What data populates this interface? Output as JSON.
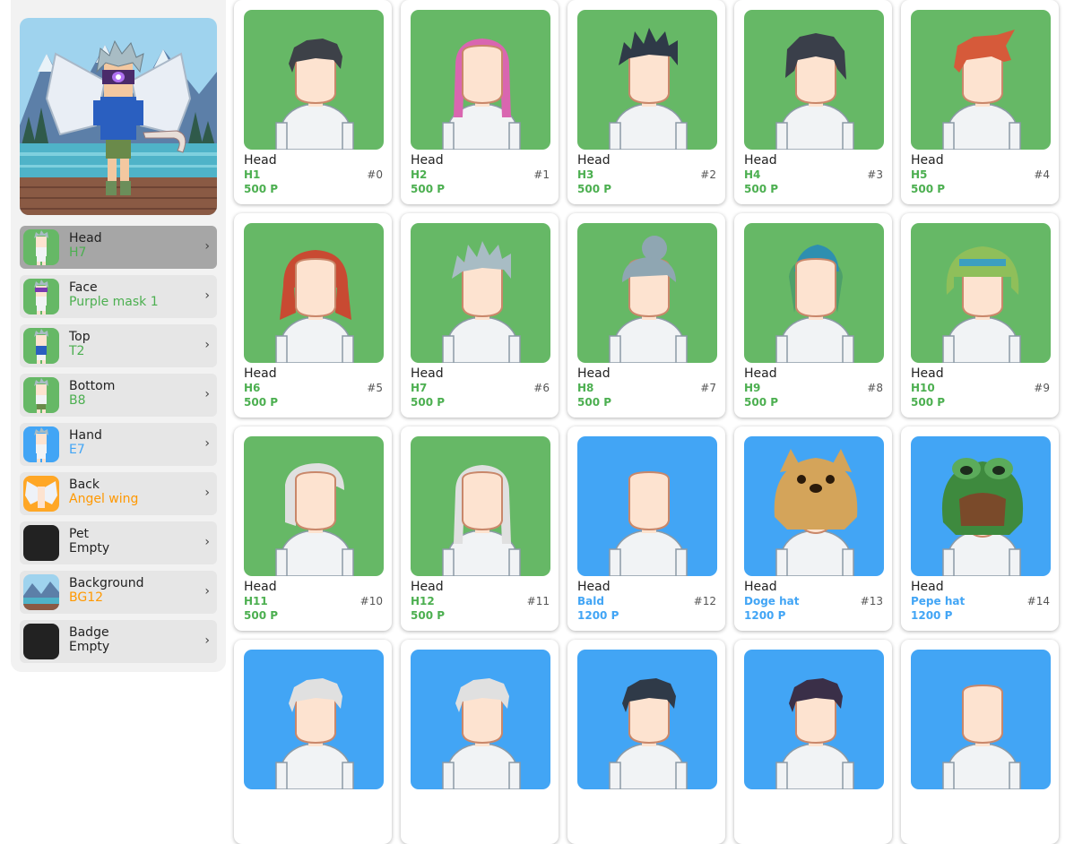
{
  "colors": {
    "green_bg": "#66b866",
    "blue_bg": "#42a5f5",
    "green_text": "#4caf50",
    "blue_text": "#42a5f5",
    "orange_text": "#ff9800"
  },
  "slots": [
    {
      "label": "Head",
      "value": "H7",
      "value_color": "#4caf50",
      "selected": true,
      "thumb_bg": "#66b866",
      "thumb": "head-h7"
    },
    {
      "label": "Face",
      "value": "Purple mask 1",
      "value_color": "#4caf50",
      "selected": false,
      "thumb_bg": "#66b866",
      "thumb": "purple-mask"
    },
    {
      "label": "Top",
      "value": "T2",
      "value_color": "#4caf50",
      "selected": false,
      "thumb_bg": "#66b866",
      "thumb": "top-t2"
    },
    {
      "label": "Bottom",
      "value": "B8",
      "value_color": "#4caf50",
      "selected": false,
      "thumb_bg": "#66b866",
      "thumb": "bottom-b8"
    },
    {
      "label": "Hand",
      "value": "E7",
      "value_color": "#42a5f5",
      "selected": false,
      "thumb_bg": "#42a5f5",
      "thumb": "hand-e7"
    },
    {
      "label": "Back",
      "value": "Angel wing",
      "value_color": "#ff9800",
      "selected": false,
      "thumb_bg": "#ffa726",
      "thumb": "angel-wing"
    },
    {
      "label": "Pet",
      "value": "Empty",
      "value_color": "#222222",
      "selected": false,
      "thumb_bg": "#222222",
      "thumb": "empty"
    },
    {
      "label": "Background",
      "value": "BG12",
      "value_color": "#ff9800",
      "selected": false,
      "thumb_bg": "#6fb7d9",
      "thumb": "bg12"
    },
    {
      "label": "Badge",
      "value": "Empty",
      "value_color": "#222222",
      "selected": false,
      "thumb_bg": "#222222",
      "thumb": "empty"
    }
  ],
  "items": [
    {
      "category": "Head",
      "name": "H1",
      "index": "#0",
      "price": "500 P",
      "bg": "#66b866",
      "text_color": "#4caf50",
      "hair": "#3d4148",
      "style": "short"
    },
    {
      "category": "Head",
      "name": "H2",
      "index": "#1",
      "price": "500 P",
      "bg": "#66b866",
      "text_color": "#4caf50",
      "hair": "#d966b0",
      "style": "long"
    },
    {
      "category": "Head",
      "name": "H3",
      "index": "#2",
      "price": "500 P",
      "bg": "#66b866",
      "text_color": "#4caf50",
      "hair": "#2f3a48",
      "style": "spiky"
    },
    {
      "category": "Head",
      "name": "H4",
      "index": "#3",
      "price": "500 P",
      "bg": "#66b866",
      "text_color": "#4caf50",
      "hair": "#3a3f4a",
      "style": "shaggy"
    },
    {
      "category": "Head",
      "name": "H5",
      "index": "#4",
      "price": "500 P",
      "bg": "#66b866",
      "text_color": "#4caf50",
      "hair": "#d65a3a",
      "style": "swept"
    },
    {
      "category": "Head",
      "name": "H6",
      "index": "#5",
      "price": "500 P",
      "bg": "#66b866",
      "text_color": "#4caf50",
      "hair": "#c84a32",
      "style": "bob"
    },
    {
      "category": "Head",
      "name": "H7",
      "index": "#6",
      "price": "500 P",
      "bg": "#66b866",
      "text_color": "#4caf50",
      "hair": "#a8bcc4",
      "style": "spiky"
    },
    {
      "category": "Head",
      "name": "H8",
      "index": "#7",
      "price": "500 P",
      "bg": "#66b866",
      "text_color": "#4caf50",
      "hair": "#8fa6b2",
      "style": "bun"
    },
    {
      "category": "Head",
      "name": "H9",
      "index": "#8",
      "price": "500 P",
      "bg": "#66b866",
      "text_color": "#4caf50",
      "hair": "#4ea06a",
      "style": "beanie"
    },
    {
      "category": "Head",
      "name": "H10",
      "index": "#9",
      "price": "500 P",
      "bg": "#66b866",
      "text_color": "#4caf50",
      "hair": "#8fbf5a",
      "style": "dreads"
    },
    {
      "category": "Head",
      "name": "H11",
      "index": "#10",
      "price": "500 P",
      "bg": "#66b866",
      "text_color": "#4caf50",
      "hair": "#e0e0e0",
      "style": "silverbob"
    },
    {
      "category": "Head",
      "name": "H12",
      "index": "#11",
      "price": "500 P",
      "bg": "#66b866",
      "text_color": "#4caf50",
      "hair": "#e0e0e0",
      "style": "long"
    },
    {
      "category": "Head",
      "name": "Bald",
      "index": "#12",
      "price": "1200 P",
      "bg": "#42a5f5",
      "text_color": "#42a5f5",
      "hair": "none",
      "style": "bald"
    },
    {
      "category": "Head",
      "name": "Doge hat",
      "index": "#13",
      "price": "1200 P",
      "bg": "#42a5f5",
      "text_color": "#42a5f5",
      "hair": "#d4a45a",
      "style": "doge"
    },
    {
      "category": "Head",
      "name": "Pepe hat",
      "index": "#14",
      "price": "1200 P",
      "bg": "#42a5f5",
      "text_color": "#42a5f5",
      "hair": "#3e8a3e",
      "style": "pepe"
    },
    {
      "category": "",
      "name": "",
      "index": "",
      "price": "",
      "bg": "#42a5f5",
      "text_color": "#42a5f5",
      "hair": "#e0e0e0",
      "style": "short"
    },
    {
      "category": "",
      "name": "",
      "index": "",
      "price": "",
      "bg": "#42a5f5",
      "text_color": "#42a5f5",
      "hair": "#e0e0e0",
      "style": "short"
    },
    {
      "category": "",
      "name": "",
      "index": "",
      "price": "",
      "bg": "#42a5f5",
      "text_color": "#42a5f5",
      "hair": "#2f3a48",
      "style": "short"
    },
    {
      "category": "",
      "name": "",
      "index": "",
      "price": "",
      "bg": "#42a5f5",
      "text_color": "#42a5f5",
      "hair": "#3a2f48",
      "style": "short"
    },
    {
      "category": "",
      "name": "",
      "index": "",
      "price": "",
      "bg": "#42a5f5",
      "text_color": "#42a5f5",
      "hair": "none",
      "style": "bald"
    }
  ]
}
